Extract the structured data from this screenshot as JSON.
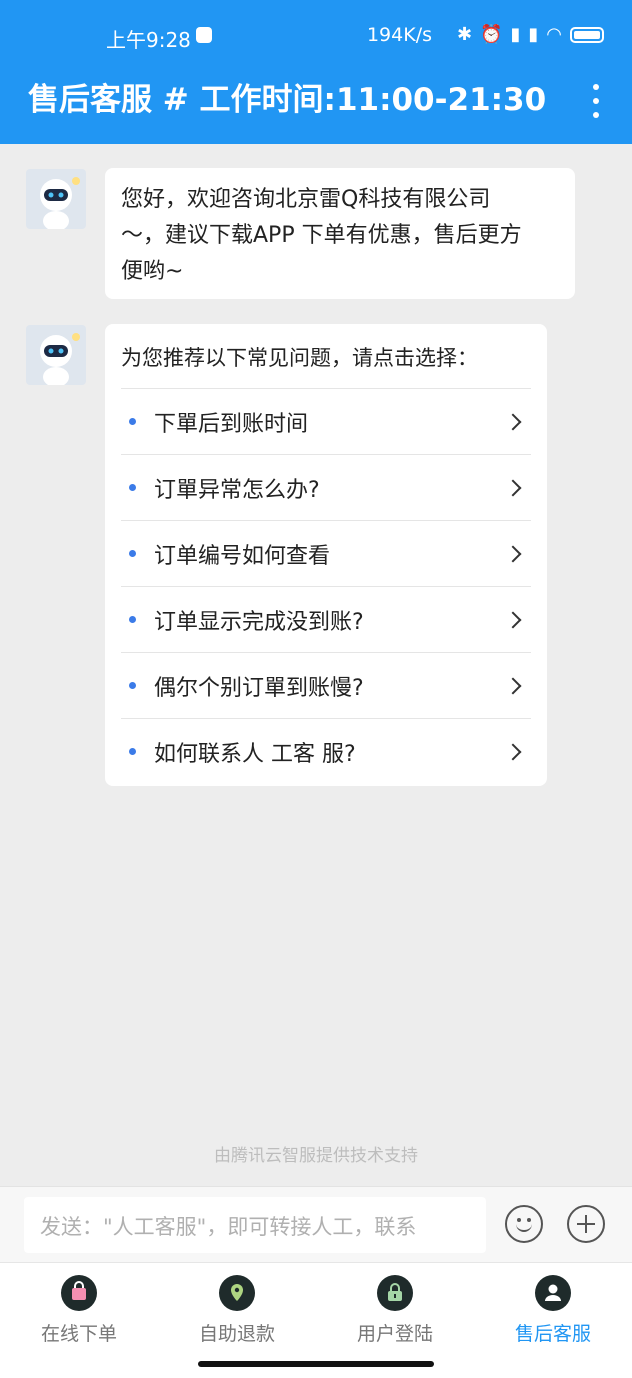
{
  "status_bar": {
    "time": "上午9:28",
    "network_speed": "194K/s",
    "icons": [
      "bluetooth-icon",
      "alarm-icon",
      "signal-icon",
      "signal-icon",
      "wifi-icon",
      "battery-icon"
    ]
  },
  "header": {
    "title": "售后客服 # 工作时间:11:00-21:30",
    "more_icon": "more-vertical-icon"
  },
  "messages": [
    {
      "text_lines": [
        "您好，欢迎咨询北京雷Q科技有限公司",
        "～，建议下载APP 下单有优惠，售后更方",
        "便哟~"
      ]
    },
    {
      "title": "为您推荐以下常见问题，请点击选择：",
      "faqs": [
        "下單后到账时间",
        "订單异常怎么办?",
        "订单编号如何查看",
        "订单显示完成没到账?",
        "偶尔个别订單到账慢?",
        "如何联系人 工客 服?"
      ]
    }
  ],
  "footer_note": "由腾讯云智服提供技术支持",
  "input": {
    "placeholder": "发送：\"人工客服\"，即可转接人工，联系"
  },
  "tabs": [
    {
      "label": "在线下单",
      "icon": "shopping-bag-icon",
      "active": false
    },
    {
      "label": "自助退款",
      "icon": "location-pin-icon",
      "active": false
    },
    {
      "label": "用户登陆",
      "icon": "lock-icon",
      "active": false
    },
    {
      "label": "售后客服",
      "icon": "user-icon",
      "active": true
    }
  ],
  "colors": {
    "primary": "#2196f3",
    "bullet": "#3b7be8"
  }
}
